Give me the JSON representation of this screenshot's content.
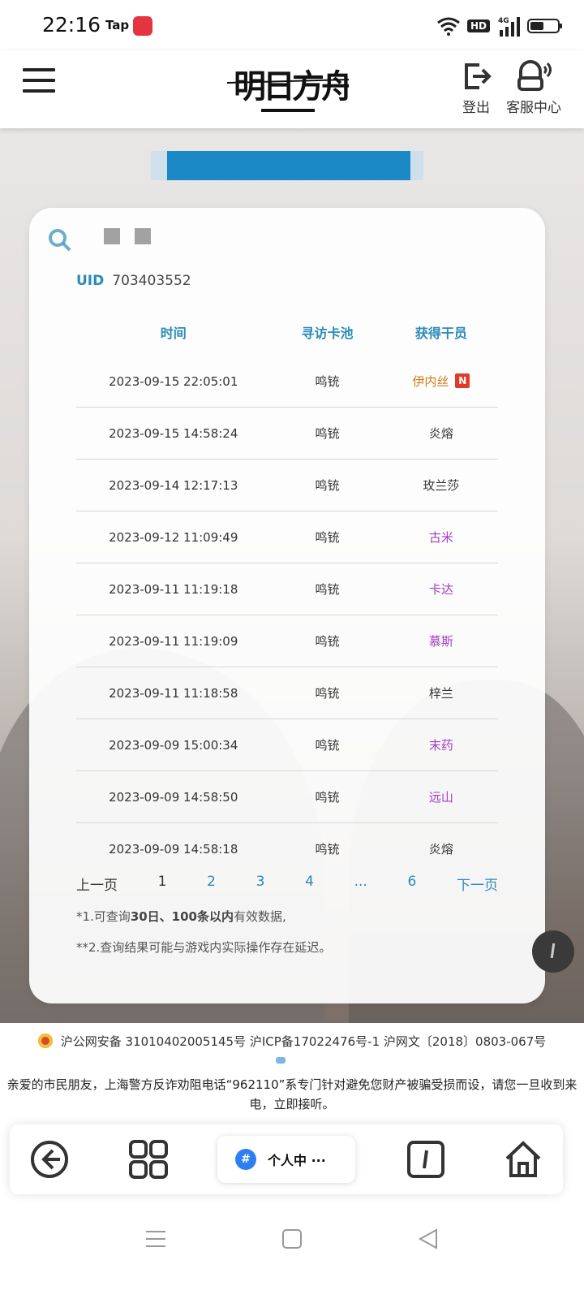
{
  "status_bar": {
    "time": "22:16",
    "tap_label": "Tap",
    "hd_label": "HD",
    "network_label": "4G"
  },
  "header": {
    "logo_text": "明日方舟",
    "logout_label": "登出",
    "service_label": "客服中心"
  },
  "uid": {
    "label": "UID",
    "value": "703403552"
  },
  "table": {
    "headers": [
      "时间",
      "寻访卡池",
      "获得干员"
    ],
    "rows": [
      {
        "time": "2023-09-15 22:05:01",
        "pool": "鸣铳",
        "operator": "伊内丝",
        "color": "#d07a1a",
        "new_badge": "N"
      },
      {
        "time": "2023-09-15 14:58:24",
        "pool": "鸣铳",
        "operator": "炎熔",
        "color": "#333333"
      },
      {
        "time": "2023-09-14 12:17:13",
        "pool": "鸣铳",
        "operator": "玫兰莎",
        "color": "#333333"
      },
      {
        "time": "2023-09-12 11:09:49",
        "pool": "鸣铳",
        "operator": "古米",
        "color": "#a03ec2"
      },
      {
        "time": "2023-09-11 11:19:18",
        "pool": "鸣铳",
        "operator": "卡达",
        "color": "#a03ec2"
      },
      {
        "time": "2023-09-11 11:19:09",
        "pool": "鸣铳",
        "operator": "慕斯",
        "color": "#a03ec2"
      },
      {
        "time": "2023-09-11 11:18:58",
        "pool": "鸣铳",
        "operator": "梓兰",
        "color": "#333333"
      },
      {
        "time": "2023-09-09 15:00:34",
        "pool": "鸣铳",
        "operator": "末药",
        "color": "#a03ec2"
      },
      {
        "time": "2023-09-09 14:58:50",
        "pool": "鸣铳",
        "operator": "远山",
        "color": "#a03ec2"
      },
      {
        "time": "2023-09-09 14:58:18",
        "pool": "鸣铳",
        "operator": "炎熔",
        "color": "#333333"
      }
    ]
  },
  "pagination": {
    "prev": "上一页",
    "pages": [
      "1",
      "2",
      "3",
      "4",
      "...",
      "6"
    ],
    "current": "1",
    "next": "下一页"
  },
  "notes": {
    "note1_prefix": "*1.可查询",
    "note1_bold": "30日、100条以内",
    "note1_suffix": "有效数据,",
    "note2": "**2.查询结果可能与游戏内实际操作存在延迟。"
  },
  "footer": {
    "registration": "沪公网安备 31010402005145号 沪ICP备17022476号-1 沪网文〔2018〕0803-067号",
    "notice": "亲爱的市民朋友，上海警方反诈劝阻电话“962110”系专门针对避免您财产被骗受损而设，请您一旦收到来电，立即接听。"
  },
  "browser_bar": {
    "tab_hash": "#",
    "tab_label": "个人中 ···"
  },
  "colors": {
    "accent": "#2b8bb8",
    "purple_operator": "#a03ec2",
    "orange_operator": "#d07a1a",
    "new_badge": "#e03b2a"
  }
}
